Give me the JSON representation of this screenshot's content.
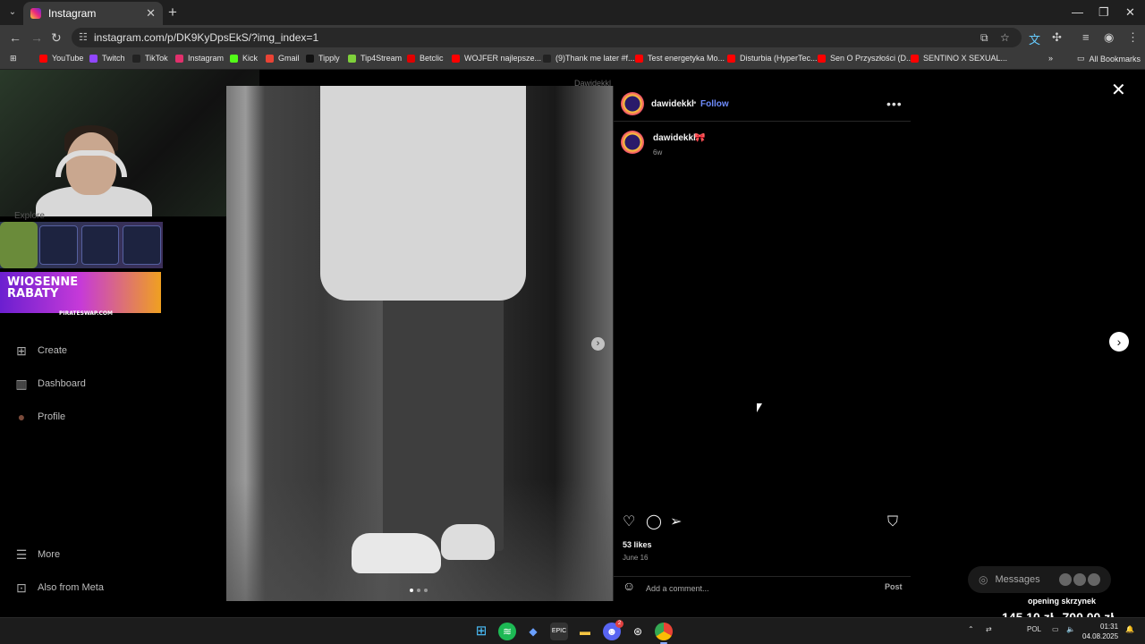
{
  "browser": {
    "tab_title": "Instagram",
    "tab_close": "✕",
    "new_tab": "+",
    "url": "instagram.com/p/DK9KyDpsEkS/?img_index=1",
    "bookmarks": [
      {
        "label": "YouTube",
        "color": "#ff0000"
      },
      {
        "label": "Twitch",
        "color": "#9146ff"
      },
      {
        "label": "TikTok",
        "color": "#222222"
      },
      {
        "label": "Instagram",
        "color": "#e1306c"
      },
      {
        "label": "Kick",
        "color": "#53fc18"
      },
      {
        "label": "Gmail",
        "color": "#ea4335"
      },
      {
        "label": "Tipply",
        "color": "#111111"
      },
      {
        "label": "Tip4Stream",
        "color": "#7fd13b"
      },
      {
        "label": "Betclic",
        "color": "#e00000"
      },
      {
        "label": "WOJFER najlepsze...",
        "color": "#ff0000"
      },
      {
        "label": "(9)Thank me later #f...",
        "color": "#222222"
      },
      {
        "label": "Test energetyka Mo...",
        "color": "#ff0000"
      },
      {
        "label": "Disturbia (HyperTec...",
        "color": "#ff0000"
      },
      {
        "label": "Sen O Przyszłości (D...",
        "color": "#ff0000"
      },
      {
        "label": "SENTINO X SEXUAL...",
        "color": "#ff0000"
      }
    ],
    "all_bookmarks": "All Bookmarks",
    "bookmarks_overflow": "»"
  },
  "sidebar": {
    "explore_faint": "Explore",
    "promo_text_line1": "WIOSENNE",
    "promo_text_line2": "RABATY",
    "promo_site": "PIRATESWAP.COM",
    "items": [
      {
        "label": "Create",
        "icon": "plus-square-icon"
      },
      {
        "label": "Dashboard",
        "icon": "chart-icon"
      },
      {
        "label": "Profile",
        "icon": "avatar-icon"
      },
      {
        "label": "More",
        "icon": "hamburger-icon"
      },
      {
        "label": "Also from Meta",
        "icon": "meta-icon"
      }
    ]
  },
  "post": {
    "faint_name": "Dawidekkl",
    "username": "dawidekkl",
    "separator": "•",
    "follow_label": "Follow",
    "caption_username": "dawidekkl",
    "caption_emoji": "🎀",
    "age": "6w",
    "likes": "53 likes",
    "date": "June 16",
    "comment_placeholder": "Add a comment...",
    "post_label": "Post",
    "more_label": "•••"
  },
  "overlay": {
    "messages_label": "Messages",
    "title": "opening skrzynek",
    "amount1": "145,10 zł",
    "amount2": "700,00 zł"
  },
  "taskbar": {
    "discord_badge": "2",
    "lang": "POL",
    "time": "01:31",
    "date": "04.08.2025"
  }
}
